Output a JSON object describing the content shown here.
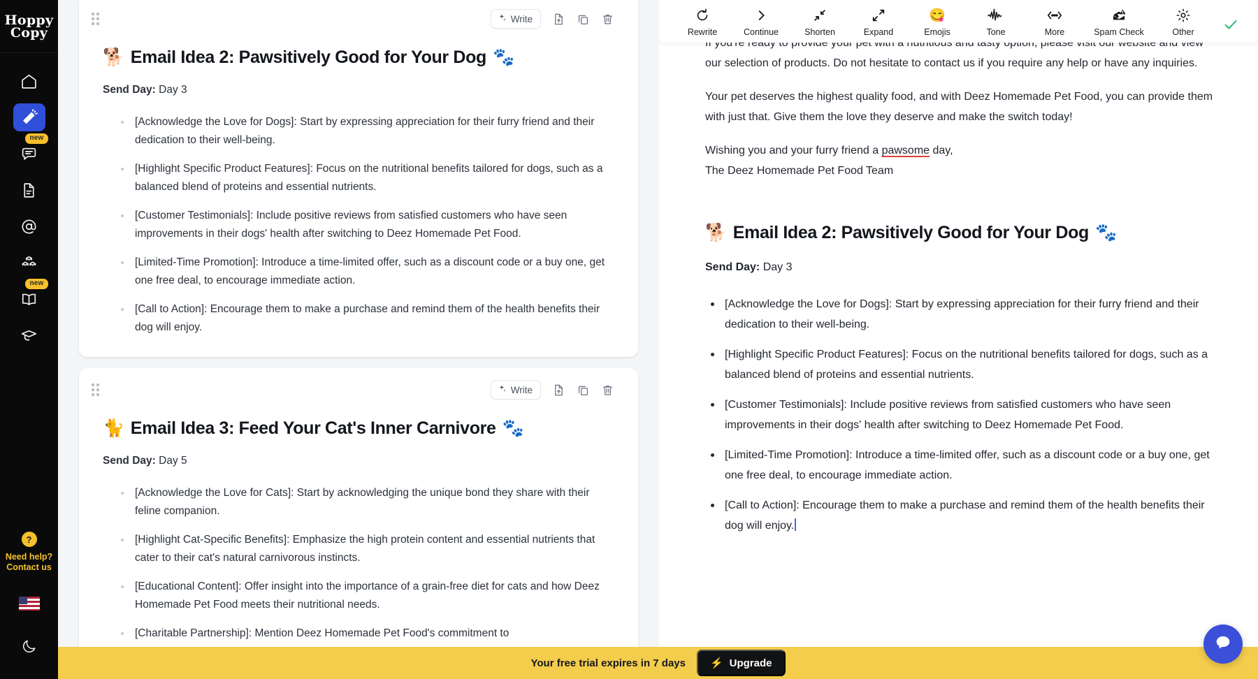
{
  "brand": {
    "line1": "Hoppy",
    "line2": "Copy"
  },
  "sidebar": {
    "items": [
      {
        "name": "home",
        "icon": "home-icon",
        "badge": null
      },
      {
        "name": "ai-writer",
        "icon": "magic-wand-icon",
        "badge": null,
        "active": true
      },
      {
        "name": "chat",
        "icon": "chat-bubble-icon",
        "badge": "new"
      },
      {
        "name": "documents",
        "icon": "document-icon",
        "badge": null
      },
      {
        "name": "email-at",
        "icon": "at-sign-icon",
        "badge": null
      },
      {
        "name": "templates",
        "icon": "blocks-icon",
        "badge": null
      },
      {
        "name": "library",
        "icon": "book-open-icon",
        "badge": "new"
      },
      {
        "name": "academy",
        "icon": "graduation-cap-icon",
        "badge": null
      }
    ],
    "help": {
      "line1": "Need help?",
      "line2": "Contact us",
      "icon": "question-mark-icon"
    },
    "language": "us-flag-icon",
    "theme_toggle": "moon-icon"
  },
  "toolbar": {
    "tools": [
      {
        "label": "Rewrite",
        "icon": "rotate-icon"
      },
      {
        "label": "Continue",
        "icon": "chevron-right-icon"
      },
      {
        "label": "Shorten",
        "icon": "arrows-in-icon"
      },
      {
        "label": "Expand",
        "icon": "arrows-out-icon"
      },
      {
        "label": "Emojis",
        "icon": "smiley-emoji-icon"
      },
      {
        "label": "Tone",
        "icon": "waveform-icon"
      },
      {
        "label": "More",
        "icon": "ellipsis-arrows-icon"
      },
      {
        "label": "Spam Check",
        "icon": "spam-inbox-icon"
      },
      {
        "label": "Other",
        "icon": "gear-icon"
      }
    ],
    "accept_icon": "check-icon",
    "accept_color": "#2eb872"
  },
  "cards": [
    {
      "write_label": "Write",
      "write_icon": "sparkles-icon",
      "actions": [
        "export-document-icon",
        "copy-document-icon",
        "delete-icon"
      ],
      "title_emoji_left": "🐕",
      "title": "Email Idea 2: Pawsitively Good for Your Dog",
      "title_emoji_right": "🐾",
      "send_day_label": "Send Day:",
      "send_day_value": "Day 3",
      "bullets": [
        "[Acknowledge the Love for Dogs]: Start by expressing appreciation for their furry friend and their dedication to their well-being.",
        "[Highlight Specific Product Features]: Focus on the nutritional benefits tailored for dogs, such as a balanced blend of proteins and essential nutrients.",
        "[Customer Testimonials]: Include positive reviews from satisfied customers who have seen improvements in their dogs' health after switching to Deez Homemade Pet Food.",
        "[Limited-Time Promotion]: Introduce a time-limited offer, such as a discount code or a buy one, get one free deal, to encourage immediate action.",
        "[Call to Action]: Encourage them to make a purchase and remind them of the health benefits their dog will enjoy."
      ]
    },
    {
      "write_label": "Write",
      "write_icon": "sparkles-icon",
      "actions": [
        "export-document-icon",
        "copy-document-icon",
        "delete-icon"
      ],
      "title_emoji_left": "🐈",
      "title": "Email Idea 3: Feed Your Cat's Inner Carnivore",
      "title_emoji_right": "🐾",
      "send_day_label": "Send Day:",
      "send_day_value": "Day 5",
      "bullets": [
        "[Acknowledge the Love for Cats]: Start by acknowledging the unique bond they share with their feline companion.",
        "[Highlight Cat-Specific Benefits]: Emphasize the high protein content and essential nutrients that cater to their cat's natural carnivorous instincts.",
        "[Educational Content]: Offer insight into the importance of a grain-free diet for cats and how Deez Homemade Pet Food meets their nutritional needs.",
        "[Charitable Partnership]: Mention Deez Homemade Pet Food's commitment to"
      ]
    }
  ],
  "editor": {
    "paragraph_clipped": "If you're ready to provide your pet with a nutritious and tasty option, please visit our website and view our selection of products. Do not hesitate to contact us if you require any help or have any inquiries.",
    "paragraph_2": "Your pet deserves the highest quality food, and with Deez Homemade Pet Food, you can provide them with just that. Give them the love they deserve and make the switch today!",
    "signoff_pre": "Wishing you and your furry friend a ",
    "signoff_misspelled": "pawsome",
    "signoff_post": " day,",
    "signoff_team": "The Deez Homemade Pet Food Team",
    "heading_emoji_left": "🐕",
    "heading": "Email Idea 2: Pawsitively Good for Your Dog",
    "heading_emoji_right": "🐾",
    "send_day_label": "Send Day:",
    "send_day_value": "Day 3",
    "bullets": [
      "[Acknowledge the Love for Dogs]: Start by expressing appreciation for their furry friend and their dedication to their well-being.",
      "[Highlight Specific Product Features]: Focus on the nutritional benefits tailored for dogs, such as a balanced blend of proteins and essential nutrients.",
      "[Customer Testimonials]: Include positive reviews from satisfied customers who have seen improvements in their dogs' health after switching to Deez Homemade Pet Food.",
      "[Limited-Time Promotion]: Introduce a time-limited offer, such as a discount code or a buy one, get one free deal, to encourage immediate action."
    ],
    "last_bullet": "[Call to Action]: Encourage them to make a purchase and remind them of the health benefits their dog will enjoy."
  },
  "trial": {
    "message": "Your free trial expires in 7 days",
    "upgrade_label": "Upgrade",
    "upgrade_icon": "lightning-bolt-icon",
    "bar_color": "#f5cd4c"
  },
  "chat_widget": {
    "icon": "chat-bubble-icon",
    "color": "#3b4fd8"
  }
}
